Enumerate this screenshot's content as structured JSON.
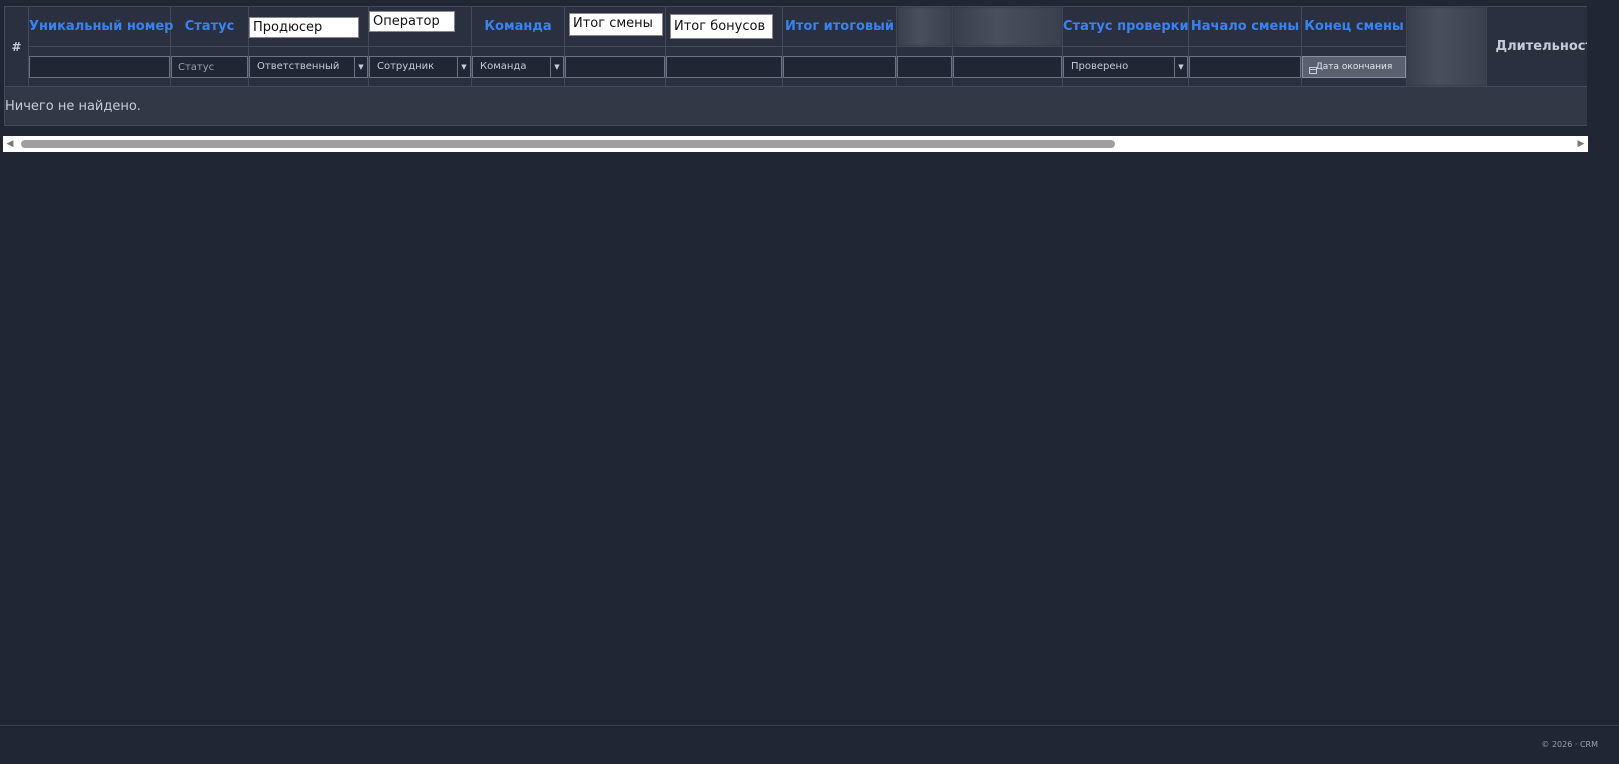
{
  "table": {
    "headers": {
      "hash": "#",
      "unique_number": "Уникальный номер",
      "status": "Статус",
      "producer": "Продюсер",
      "operator": "Оператор",
      "team": "Команда",
      "shift_total": "Итог смены",
      "bonus_total": "Итог бонусов",
      "grand_total": "Итог итоговый",
      "check_status": "Статус проверки",
      "shift_start": "Начало смены",
      "shift_end": "Конец смены",
      "duration": "Длительност"
    },
    "filters": {
      "status_placeholder": "Статус",
      "producer_select": "Ответственный",
      "operator_select": "Сотрудник",
      "team_select": "Команда",
      "check_status_select": "Проверено",
      "end_date_button": "Дата окончания"
    },
    "empty_message": "Ничего не найдено."
  },
  "footer": {
    "copyright": "© 2026 · CRM"
  },
  "icons": {
    "dropdown_arrow": "chevron-down-icon",
    "calendar": "calendar-icon",
    "scroll_left": "arrow-left-icon",
    "scroll_right": "arrow-right-icon"
  },
  "colors": {
    "background": "#212634",
    "header_link": "#3a82f0",
    "table_bg": "#2b3040"
  }
}
